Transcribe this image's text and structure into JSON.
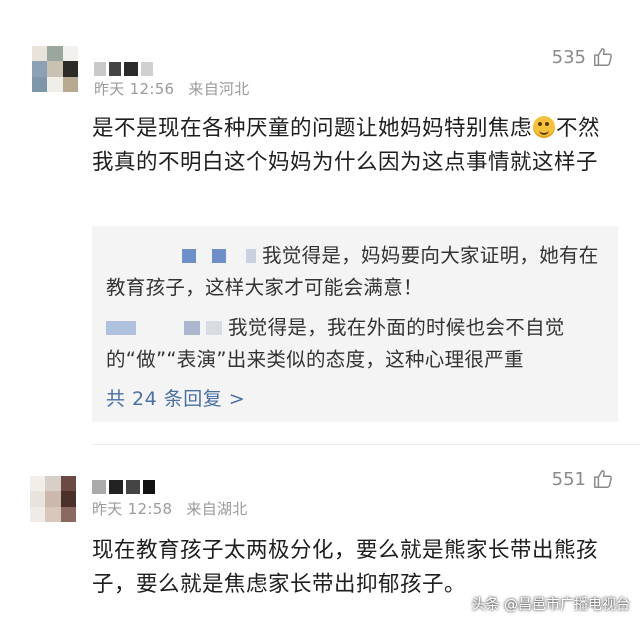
{
  "comment1": {
    "time": "昨天 12:56",
    "location": "来自河北",
    "likes": "535",
    "text_before_emoji": "是不是现在各种厌童的问题让她妈妈特别焦虑",
    "text_after_emoji": "不然我真的不明白这个妈妈为什么因为这点事情就这样子",
    "emoji": "crying-laughing-emoji",
    "replies": [
      {
        "text": "我觉得是，妈妈要向大家证明，她有在教育孩子，这样大家才可能会满意！"
      },
      {
        "text": "我觉得是，我在外面的时候也会不自觉的“做”“表演”出来类似的态度，这种心理很严重"
      }
    ],
    "more_replies": "共 24 条回复 >"
  },
  "comment2": {
    "time": "昨天 12:58",
    "location": "来自湖北",
    "likes": "551",
    "text": "现在教育孩子太两极分化，要么就是熊家长带出熊孩子，要么就是焦虑家长带出抑郁孩子。"
  },
  "watermark": "头条 @昌邑市广播电视台",
  "colors": {
    "link": "#4a6fa5",
    "meta": "#9a9a9a",
    "reply_bg": "#f4f4f4"
  }
}
